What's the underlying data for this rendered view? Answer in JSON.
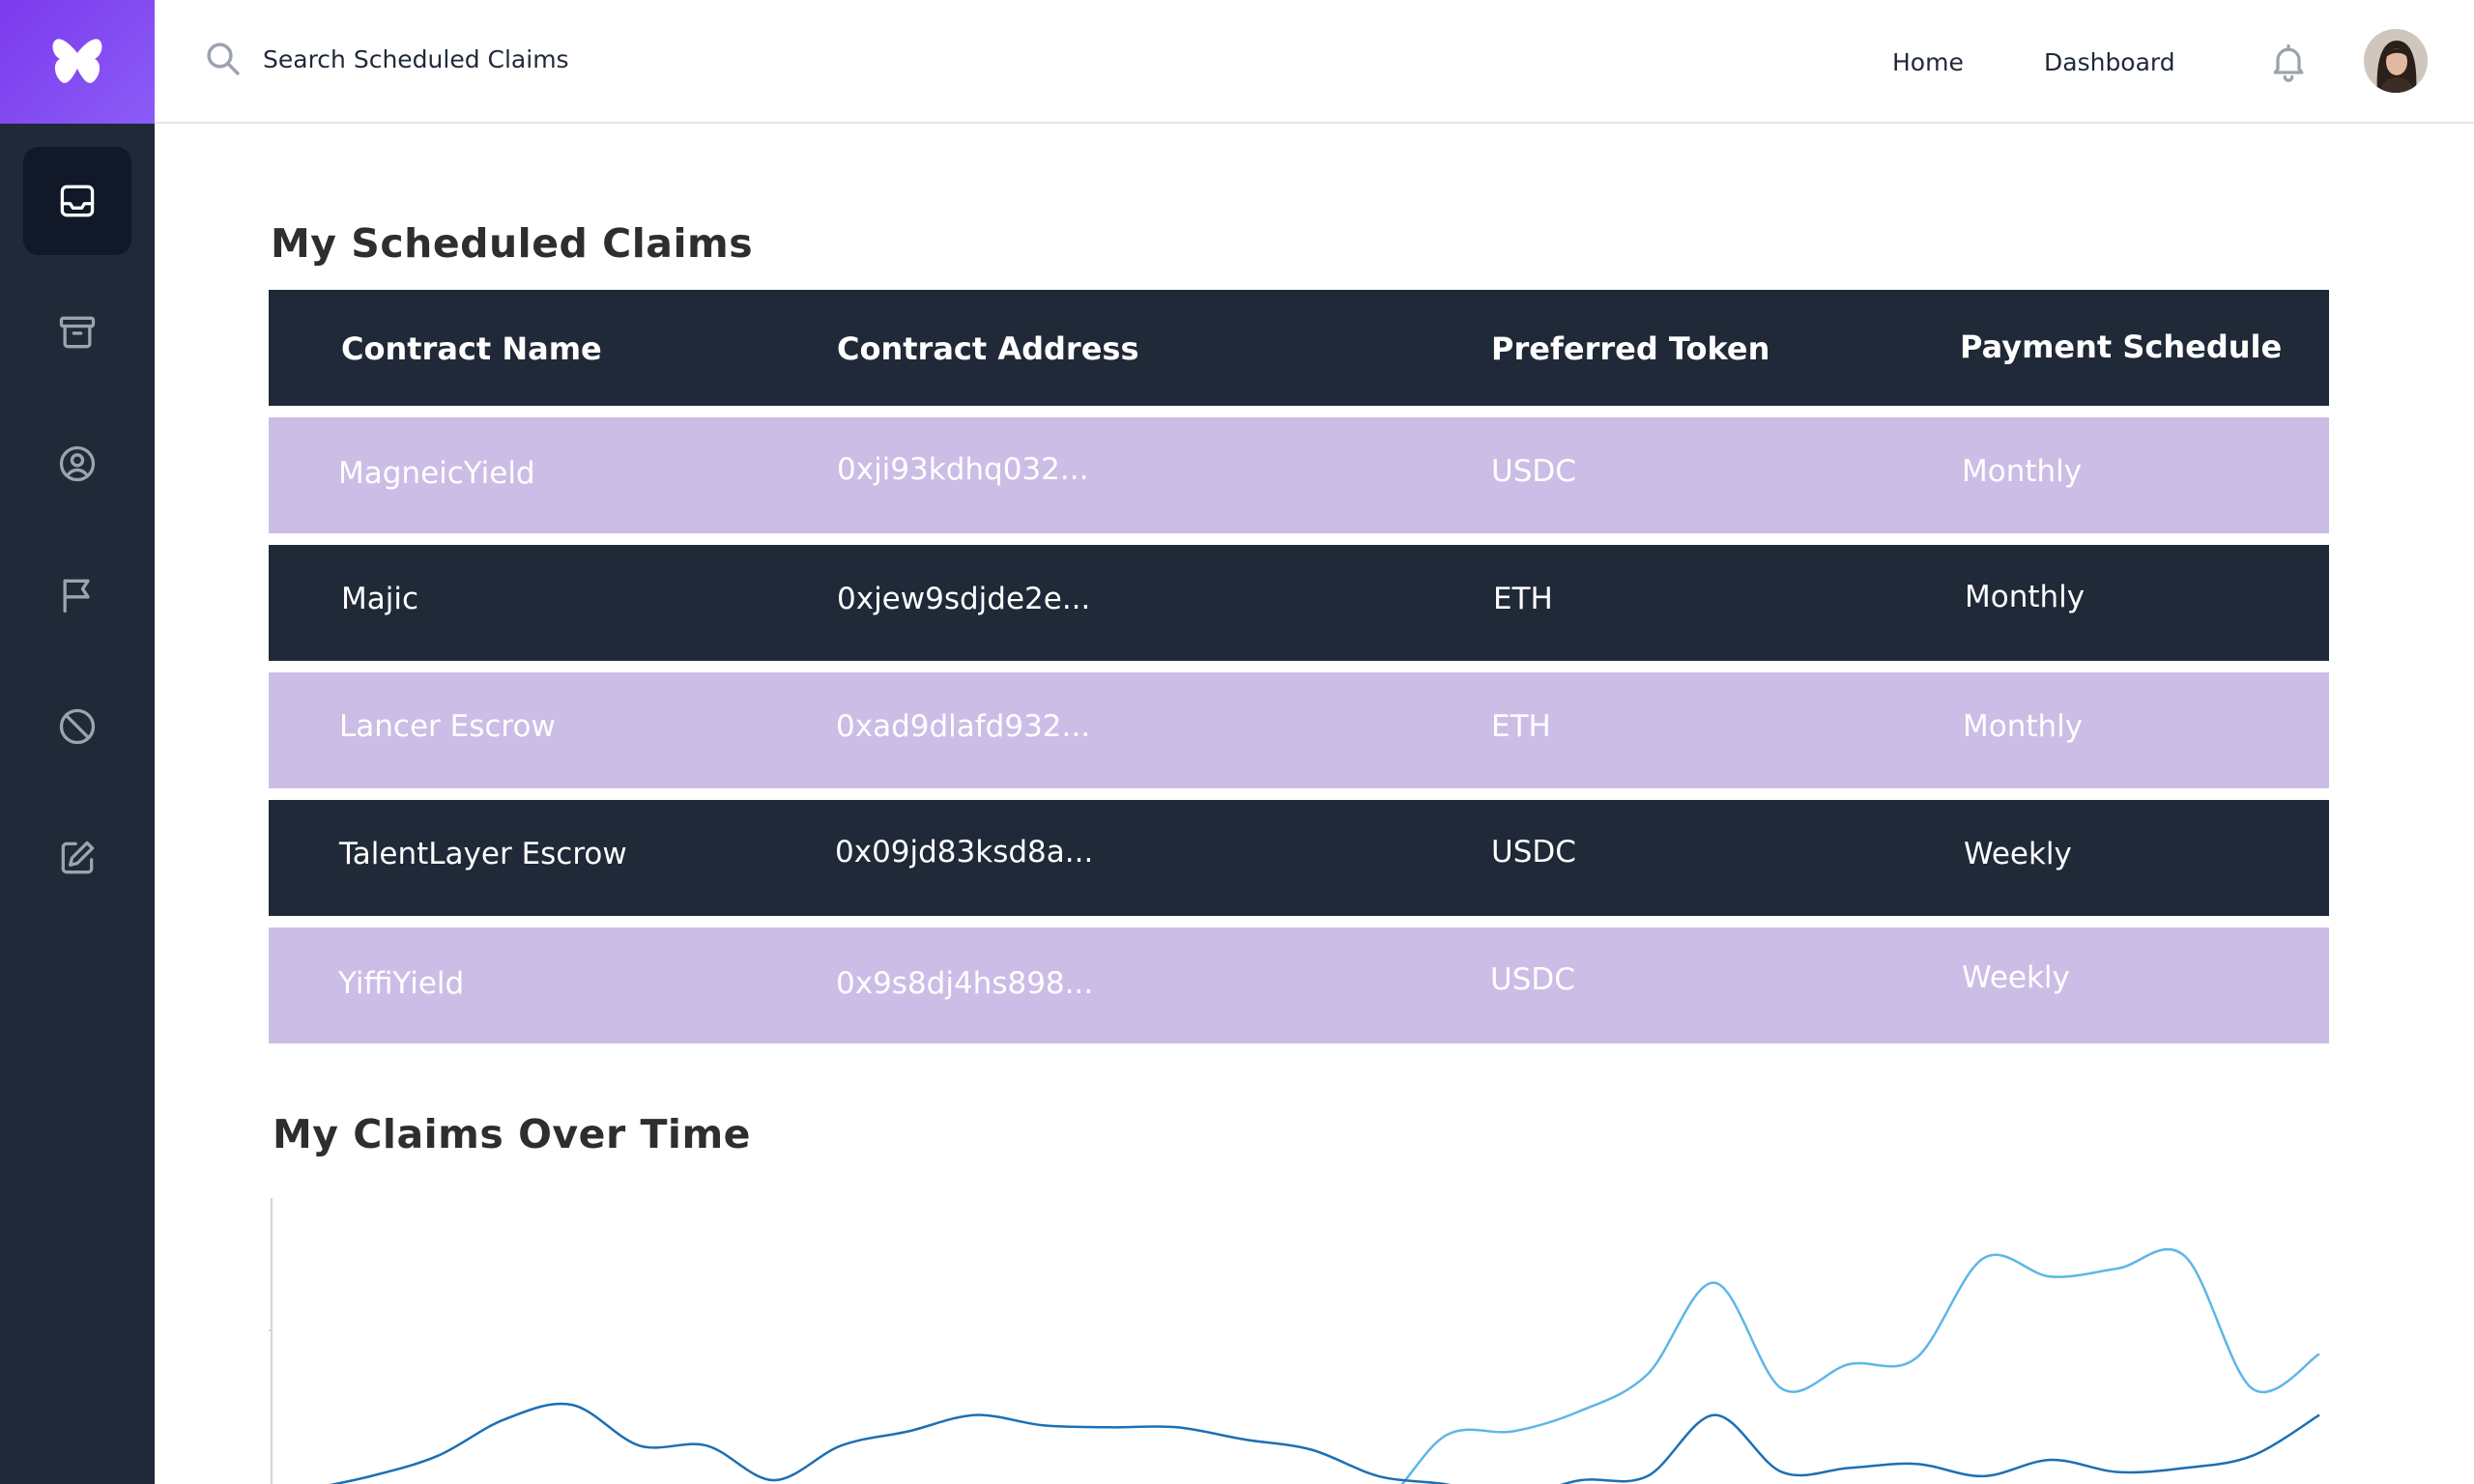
{
  "search": {
    "placeholder": "Search Scheduled Claims"
  },
  "nav": {
    "home": "Home",
    "dashboard": "Dashboard"
  },
  "sidebar": {
    "items": [
      {
        "icon": "inbox-icon",
        "active": true
      },
      {
        "icon": "archive-icon",
        "active": false
      },
      {
        "icon": "user-circle-icon",
        "active": false
      },
      {
        "icon": "flag-icon",
        "active": false
      },
      {
        "icon": "ban-icon",
        "active": false
      },
      {
        "icon": "edit-icon",
        "active": false
      }
    ]
  },
  "claims": {
    "title": "My Scheduled Claims",
    "columns": [
      "Contract Name",
      "Contract Address",
      "Preferred Token",
      "Payment Schedule"
    ],
    "rows": [
      {
        "name": "MagneicYield",
        "address": "0xji93kdhq032...",
        "token": "USDC",
        "schedule": "Monthly"
      },
      {
        "name": "Majic",
        "address": "0xjew9sdjde2e...",
        "token": "ETH",
        "schedule": "Monthly"
      },
      {
        "name": "Lancer Escrow",
        "address": "0xad9dlafd932...",
        "token": "ETH",
        "schedule": "Monthly"
      },
      {
        "name": "TalentLayer Escrow",
        "address": "0x09jd83ksd8a...",
        "token": "USDC",
        "schedule": "Weekly"
      },
      {
        "name": "YiffiYield",
        "address": "0x9s8dj4hs898...",
        "token": "USDC",
        "schedule": "Weekly"
      }
    ]
  },
  "chart_section": {
    "title": "My Claims Over Time"
  },
  "chart_data": {
    "type": "line",
    "title": "",
    "xlabel": "",
    "ylabel": "",
    "grid": false,
    "x": [
      0,
      1,
      2,
      3,
      4,
      5,
      6,
      7,
      8,
      9,
      10,
      11,
      12,
      13,
      14,
      15,
      16,
      17,
      18,
      19,
      20,
      21,
      22,
      23,
      24,
      25,
      26,
      27,
      28,
      29,
      30
    ],
    "series": [
      {
        "color": "#5eb6e8",
        "values": [
          null,
          null,
          null,
          null,
          null,
          null,
          null,
          null,
          null,
          null,
          null,
          null,
          2,
          12,
          14,
          5,
          5,
          40,
          42,
          52,
          70,
          115,
          63,
          75,
          78,
          127,
          118,
          122,
          128,
          63,
          80
        ]
      },
      {
        "color": "#1d6fb3",
        "values": [
          13,
          20,
          30,
          48,
          55,
          35,
          35,
          18,
          35,
          42,
          50,
          45,
          44,
          44,
          38,
          33,
          20,
          16,
          10,
          18,
          20,
          50,
          22,
          24,
          26,
          20,
          28,
          22,
          24,
          30,
          50
        ]
      }
    ],
    "ylim": [
      0,
      140
    ]
  }
}
